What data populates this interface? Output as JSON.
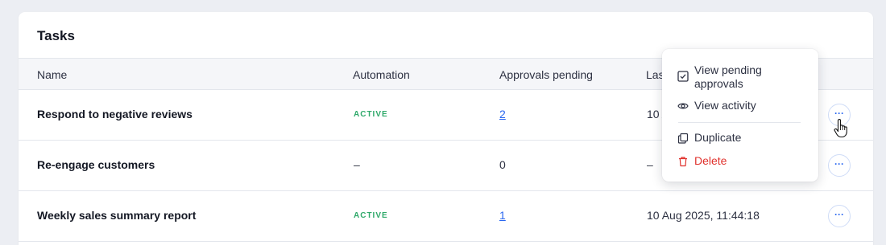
{
  "card": {
    "title": "Tasks"
  },
  "columns": {
    "name": "Name",
    "automation": "Automation",
    "approvals": "Approvals pending",
    "last_run": "Las"
  },
  "rows": [
    {
      "name": "Respond to negative reviews",
      "automation": "ACTIVE",
      "approvals": "2",
      "last_run": "10 A"
    },
    {
      "name": "Re-engage customers",
      "automation": "–",
      "approvals": "0",
      "last_run": "–"
    },
    {
      "name": "Weekly sales summary report",
      "automation": "ACTIVE",
      "approvals": "1",
      "last_run": "10 Aug 2025, 11:44:18"
    }
  ],
  "more_label": "···",
  "menu": {
    "items": [
      {
        "label": "View pending approvals",
        "icon": "checkbox-icon"
      },
      {
        "label": "View activity",
        "icon": "eye-icon"
      },
      {
        "label": "Duplicate",
        "icon": "duplicate-icon"
      },
      {
        "label": "Delete",
        "icon": "trash-icon"
      }
    ]
  },
  "colors": {
    "accent": "#2a67f0",
    "active": "#2fa96a",
    "danger": "#e0322d"
  }
}
